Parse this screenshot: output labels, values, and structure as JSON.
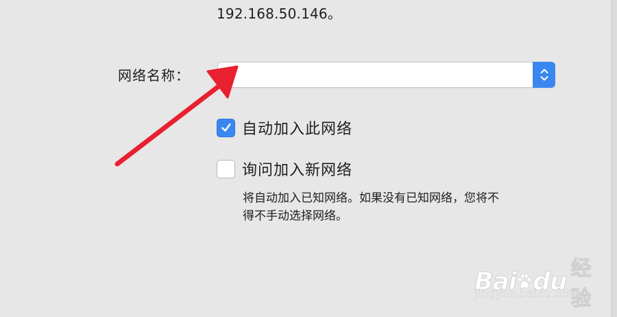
{
  "ip_text": "192.168.50.146。",
  "network_name": {
    "label": "网络名称：",
    "value": ""
  },
  "options": {
    "auto_join": {
      "label": "自动加入此网络",
      "checked": true
    },
    "ask_to_join": {
      "label": "询问加入新网络",
      "checked": false
    },
    "help_lines": [
      "将自动加入已知网络。如果没有已知网络，您将不",
      "得不手动选择网络。"
    ]
  },
  "watermark": {
    "brand_left": "Bai",
    "brand_right": "du",
    "product": "经验",
    "url": "jingyan.baidu.com"
  },
  "colors": {
    "accent": "#3b87f0",
    "annotation_arrow": "#e8202f",
    "background": "#e7e7e7"
  },
  "icons": {
    "stepper": "chevron-up-down-icon",
    "check": "checkmark-icon",
    "annotation": "red-arrow"
  }
}
